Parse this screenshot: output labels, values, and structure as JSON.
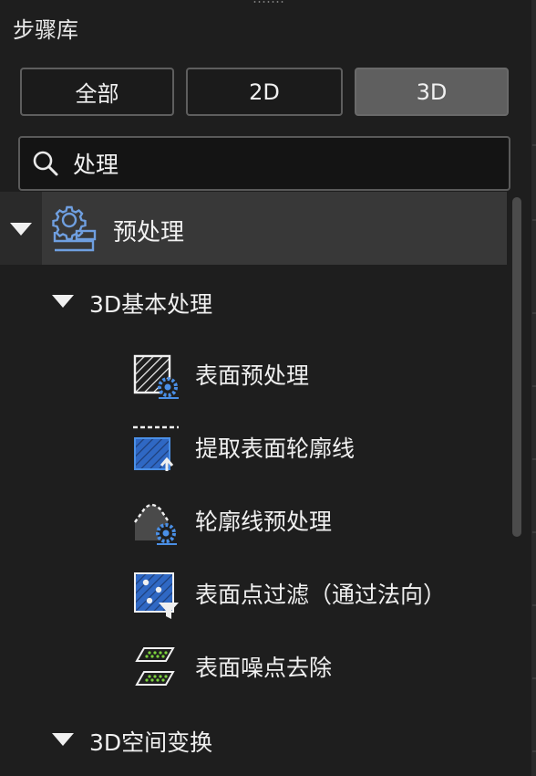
{
  "panel": {
    "title": "步骤库"
  },
  "filters": [
    {
      "label": "全部",
      "active": false
    },
    {
      "label": "2D",
      "active": false
    },
    {
      "label": "3D",
      "active": true
    }
  ],
  "search": {
    "value": "处理"
  },
  "tree": {
    "category": {
      "label": "预处理",
      "expanded": true,
      "icon": "gear-pipeline-icon"
    },
    "groups": [
      {
        "label": "3D基本处理",
        "expanded": true,
        "items": [
          {
            "label": "表面预处理",
            "icon": "surface-preprocess-icon"
          },
          {
            "label": "提取表面轮廓线",
            "icon": "extract-contour-icon"
          },
          {
            "label": "轮廓线预处理",
            "icon": "contour-preprocess-icon"
          },
          {
            "label": "表面点过滤（通过法向）",
            "icon": "normal-filter-icon"
          },
          {
            "label": "表面噪点去除",
            "icon": "noise-removal-icon"
          }
        ]
      },
      {
        "label": "3D空间变换",
        "expanded": true,
        "items": []
      }
    ]
  },
  "colors": {
    "background": "#1e1e1e",
    "selected_row": "#383838",
    "accent_blue": "#4a8fe6",
    "point_green": "#7bd23c"
  }
}
